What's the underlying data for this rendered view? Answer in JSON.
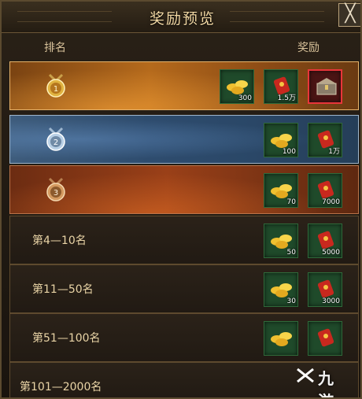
{
  "window": {
    "title": "奖励预览",
    "close_label": "╳"
  },
  "headers": {
    "rank": "排名",
    "reward": "奖励"
  },
  "rows": [
    {
      "rank_label": "",
      "medal": "gold-medal-1",
      "items": [
        {
          "icon": "gold-ingot-icon",
          "count": "300"
        },
        {
          "icon": "red-envelope-icon",
          "count": "1.5万"
        },
        {
          "icon": "treasure-chest-icon",
          "count": ""
        }
      ]
    },
    {
      "rank_label": "",
      "medal": "silver-medal-2",
      "items": [
        {
          "icon": "gold-ingot-icon",
          "count": "100"
        },
        {
          "icon": "red-envelope-icon",
          "count": "1万"
        }
      ]
    },
    {
      "rank_label": "",
      "medal": "bronze-medal-3",
      "items": [
        {
          "icon": "gold-ingot-icon",
          "count": "70"
        },
        {
          "icon": "red-envelope-icon",
          "count": "7000"
        }
      ]
    },
    {
      "rank_label": "第4—10名",
      "items": [
        {
          "icon": "gold-ingot-icon",
          "count": "50"
        },
        {
          "icon": "red-envelope-icon",
          "count": "5000"
        }
      ]
    },
    {
      "rank_label": "第11—50名",
      "items": [
        {
          "icon": "gold-ingot-icon",
          "count": "30"
        },
        {
          "icon": "red-envelope-icon",
          "count": "3000"
        }
      ]
    },
    {
      "rank_label": "第51—100名",
      "items": [
        {
          "icon": "gold-ingot-icon",
          "count": ""
        },
        {
          "icon": "red-envelope-icon",
          "count": ""
        }
      ]
    },
    {
      "rank_label": "第101—2000名",
      "items": []
    }
  ],
  "watermark": {
    "text": "九游"
  },
  "colors": {
    "gold_text": "#f3d9a4",
    "rare_border": "#e8353a",
    "item_bg": "#1f4a2a"
  }
}
